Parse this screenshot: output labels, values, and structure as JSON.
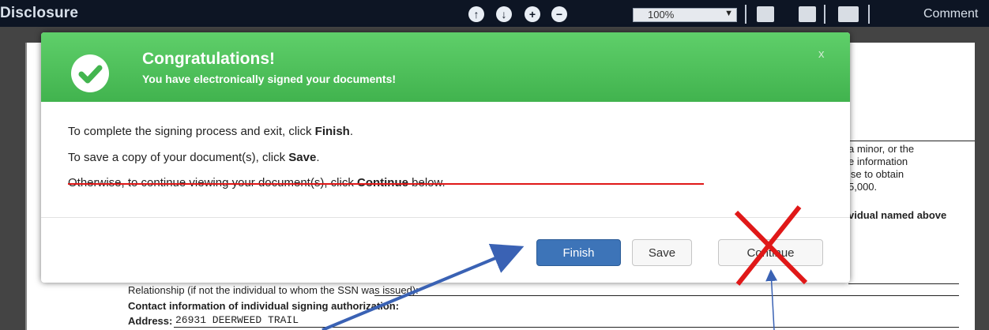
{
  "toolbar": {
    "title": "Disclosure",
    "zoom": "100%",
    "zoom_arrow": "▼",
    "comment_label": "Comment",
    "icons": [
      "arrow-up-icon",
      "arrow-down-icon",
      "zoom-in-icon",
      "zoom-out-icon",
      "fit-page-icon",
      "text-select-icon",
      "print-icon"
    ]
  },
  "doc": {
    "right_text_1": "a minor, or the",
    "right_text_2": "e information",
    "right_text_3": "lse to obtain",
    "right_text_4": "5,000.",
    "right_bold": "vidual named above",
    "relationship": "Relationship (if not the individual to whom the SSN was issued):",
    "contact": "Contact information of individual signing authorization:",
    "address_label": "Address:",
    "address_value": "26931 DEERWEED TRAIL"
  },
  "modal": {
    "title": "Congratulations!",
    "subtitle": "You have electronically signed your documents!",
    "close": "x",
    "line1_pre": "To complete the signing process and exit, click ",
    "line1_bold": "Finish",
    "line1_post": ".",
    "line2_pre": "To save a copy of your document(s), click ",
    "line2_bold": "Save",
    "line2_post": ".",
    "line3_pre": "Otherwise, to continue viewing your document(s), click ",
    "line3_bold": "Continue",
    "line3_post": " below.",
    "finish_label": "Finish",
    "save_label": "Save",
    "continue_label": "Continue"
  },
  "colors": {
    "header_green": "#4cbf58",
    "finish_blue": "#3d74b8",
    "annotation_red": "#e01818",
    "annotation_blue": "#3a62b4"
  }
}
